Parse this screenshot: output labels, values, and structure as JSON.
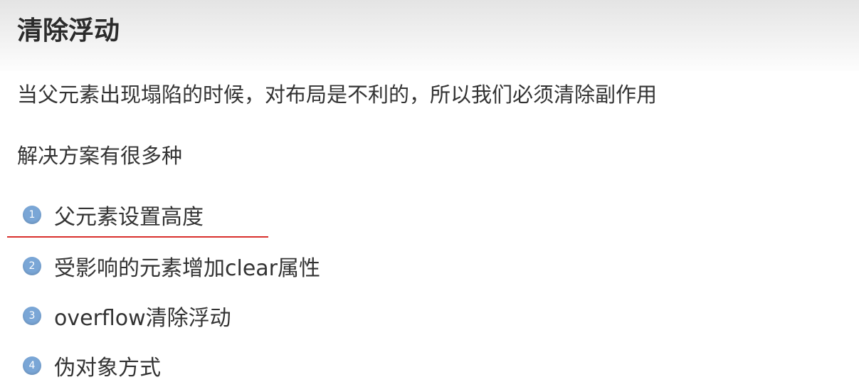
{
  "slide": {
    "title": "清除浮动",
    "paragraphs": [
      "当父元素出现塌陷的时候，对布局是不利的，所以我们必须清除副作用",
      "解决方案有很多种"
    ],
    "items": [
      {
        "number": "1",
        "label": "父元素设置高度"
      },
      {
        "number": "2",
        "label": "受影响的元素增加clear属性"
      },
      {
        "number": "3",
        "label": "overflow清除浮动"
      },
      {
        "number": "4",
        "label": "伪对象方式"
      }
    ],
    "colors": {
      "bullet": "#7aa6d6",
      "underline": "#d9302c"
    }
  }
}
